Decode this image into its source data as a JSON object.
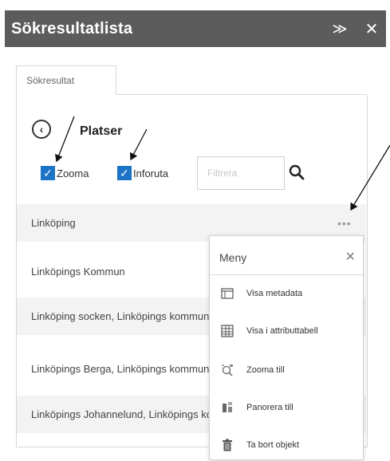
{
  "window": {
    "title": "Sökresultatlista",
    "collapse_glyph": "≫",
    "close_glyph": "✕"
  },
  "tabs": [
    {
      "label": "Sökresultat"
    }
  ],
  "section": {
    "title": "Platser",
    "back_glyph": "‹"
  },
  "options": {
    "zoom": {
      "label": "Zooma",
      "checked": true
    },
    "infopopup": {
      "label": "Inforuta",
      "checked": true
    },
    "check_glyph": "✓"
  },
  "filter": {
    "placeholder": "Filtrera",
    "value": ""
  },
  "results": [
    {
      "label": "Linköping"
    },
    {
      "label": "Linköpings Kommun"
    },
    {
      "label": "Linköping socken, Linköpings kommun"
    },
    {
      "label": "Linköpings Berga, Linköpings kommun"
    },
    {
      "label": "Linköpings Johannelund, Linköpings kommun"
    }
  ],
  "row_menu_glyph": "•••",
  "menu": {
    "title": "Meny",
    "close_glyph": "×",
    "items": [
      {
        "label": "Visa metadata",
        "icon": "metadata-icon"
      },
      {
        "label": "Visa i attributtabell",
        "icon": "table-icon"
      },
      {
        "label": "Zooma till",
        "icon": "zoom-to-icon"
      },
      {
        "label": "Panorera till",
        "icon": "pan-icon"
      },
      {
        "label": "Ta bort objekt",
        "icon": "trash-icon"
      }
    ]
  },
  "colors": {
    "titlebar": "#5c5c5c",
    "accent": "#1b74c5",
    "row_alt": "#f3f3f3"
  }
}
